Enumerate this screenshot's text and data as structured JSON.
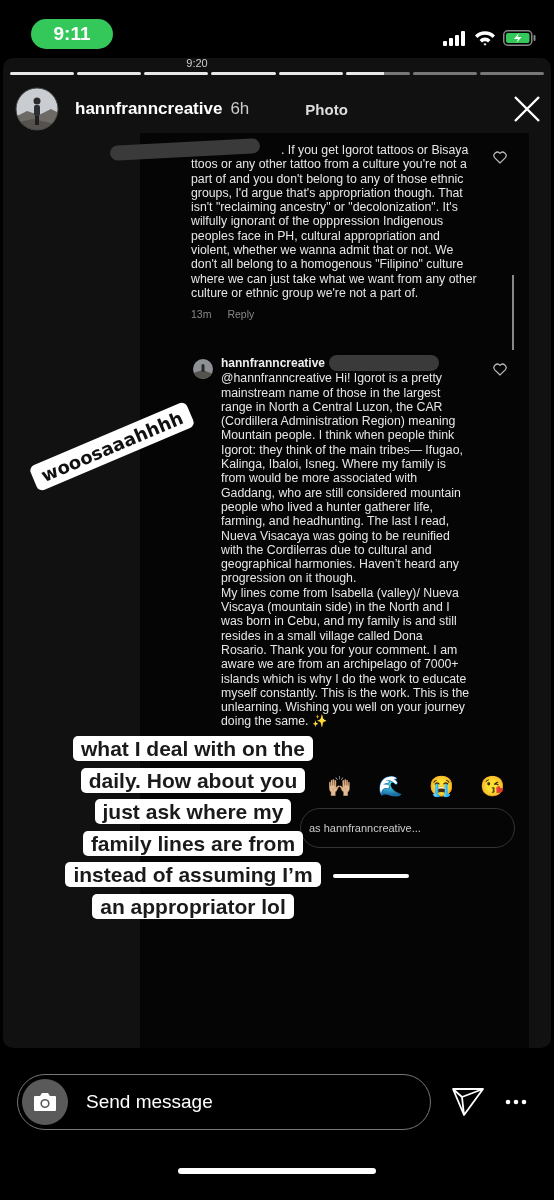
{
  "status_bar": {
    "time": "9:11"
  },
  "story": {
    "screenshot_time": "9:20",
    "progress": [
      {
        "level": 1
      },
      {
        "level": 1
      },
      {
        "level": 1
      },
      {
        "level": 1
      },
      {
        "level": 1
      },
      {
        "level": 0.6
      },
      {
        "level": 0
      },
      {
        "level": 0
      }
    ],
    "user": {
      "name": "hannfranncreative",
      "age": "6h",
      "media_label": "Photo"
    },
    "comments": [
      {
        "text": ". If you get Igorot tattoos or Bisaya ttoos or any other tattoo from a culture you're not a part of and you don't belong to any of those ethnic groups, I'd argue that's appropriation though. That isn't \"reclaiming ancestry\" or \"decolonization\". It's wilfully ignorant of the opppression Indigenous peoples face in PH, cultural appropriation and violent, whether we wanna admit that or not. We don't all belong to a homogenous \"Filipino\" culture where we can just take what we want from any other culture or ethnic group we're not a part of.",
        "time": "13m",
        "action": "Reply",
        "liked": false
      },
      {
        "author": "hannfranncreative",
        "text": "@hannfranncreative Hi! Igorot is a pretty mainstream name of those in the largest range in North a Central Luzon, the CAR (Cordillera Administration Region) meaning Mountain people. I think when people think Igorot: they think of the main tribes— Ifugao, Kalinga, Ibaloi, Isneg. Where my family is from would be more associated with Gaddang, who are still considered mountain people who lived a hunter gatherer life, farming, and headhunting. The last I read, Nueva Visacaya was going to be reunified with the Cordilerras due to cultural and geographical harmonies. Haven’t heard any progression on it though.\nMy lines come from Isabella (valley)/ Nueva Viscaya (mountain side) in the North and I was born in Cebu, and my family is and still resides in a small village called Dona Rosario. Thank you for your comment. I am aware we are from an archipelago of 7000+ islands which is why I do the work to educate myself constantly.   This is the work. This is the unlearning. Wishing you well on your journey doing the same. ✨",
        "liked": false
      }
    ],
    "emoji_reactions": [
      "🙌🏼",
      "🌊",
      "😭",
      "😘"
    ],
    "comment_field": {
      "placeholder": "as hannfranncreative..."
    },
    "stickers": [
      {
        "kind": "label",
        "text": "wooosaaahhhh"
      },
      {
        "kind": "caption",
        "text": "what I deal with on the\ndaily. How about you\njust ask where my\nfamily lines are from\ninstead of assuming I’m\nan appropriator lol"
      }
    ]
  },
  "reply_bar": {
    "placeholder": "Send message"
  }
}
